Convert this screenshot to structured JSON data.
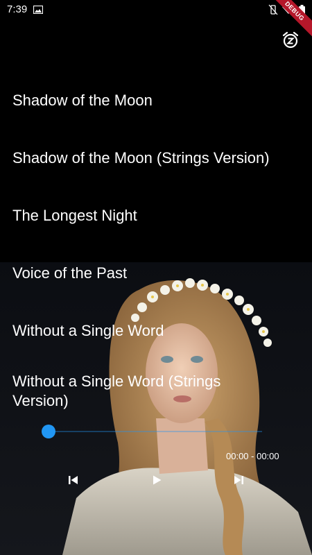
{
  "status_bar": {
    "time": "7:39",
    "debug_banner": "DEBUG",
    "left_icons": [
      "image-icon"
    ],
    "right_icons": [
      "vibrate-mute-icon",
      "wifi-icon",
      "battery-icon"
    ]
  },
  "toolbar": {
    "icons": [
      "sleep-timer-icon"
    ]
  },
  "tracks": [
    {
      "title": "Shadow of the Moon"
    },
    {
      "title": "Shadow of the Moon (Strings Version)"
    },
    {
      "title": "The Longest Night"
    },
    {
      "title": "Voice of the Past"
    },
    {
      "title": "Without a Single Word"
    },
    {
      "title": "Without a Single Word (Strings Version)"
    }
  ],
  "player": {
    "progress": 0,
    "time_display": "00:00 - 00:00",
    "accent_color": "#2196F3",
    "controls": [
      "skip-previous-icon",
      "play-icon",
      "skip-next-icon"
    ]
  }
}
